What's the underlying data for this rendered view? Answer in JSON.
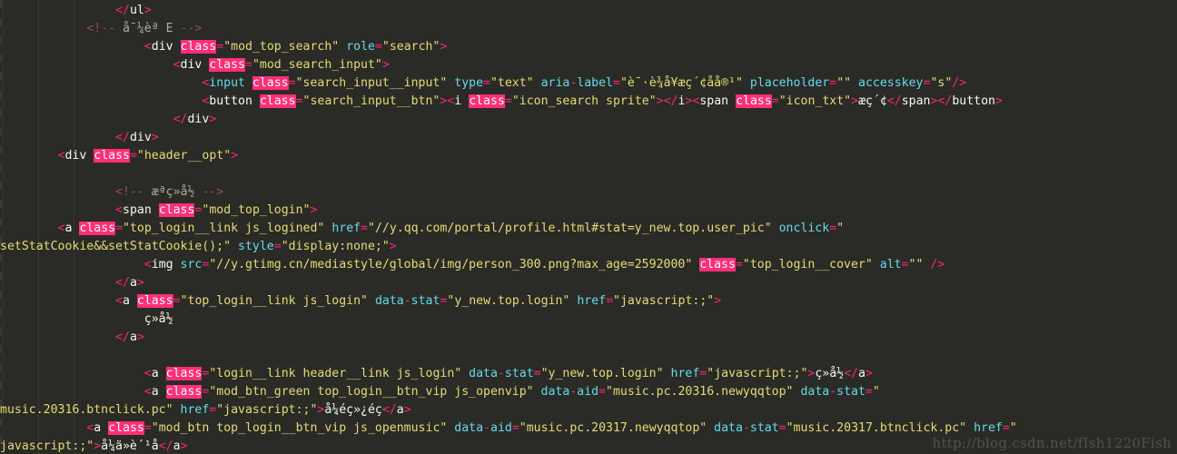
{
  "editor": {
    "title": "HTML source code editor",
    "theme": "Monokai",
    "colors": {
      "background": "#2a2b26",
      "foreground": "#f8f8f2",
      "punctuation": "#f92672",
      "attribute": "#66d9ef",
      "string": "#e6db74",
      "comment": "#9a4a55",
      "highlight_bg": "#ff2e79",
      "highlight_fg": "#ffffff",
      "indent_guide": "#3b3c36"
    },
    "search_highlight_term": "class"
  },
  "watermark": "http://blog.csdn.net/fIsh1220Fish",
  "lines": [
    {
      "id": "line-1",
      "indent": "                ",
      "tokens": [
        {
          "t": "pn",
          "s": "</"
        },
        {
          "t": "tag",
          "s": "ul"
        },
        {
          "t": "pn",
          "s": ">"
        }
      ]
    },
    {
      "id": "line-2",
      "indent": "            ",
      "tokens": [
        {
          "t": "cmt",
          "s": "<!-- "
        },
        {
          "t": "cmtt",
          "s": "å¯¼èª E"
        },
        {
          "t": "cmt",
          "s": " -->"
        }
      ]
    },
    {
      "id": "line-3",
      "indent": "                    ",
      "tokens": [
        {
          "t": "pn",
          "s": "<"
        },
        {
          "t": "tag",
          "s": "div"
        },
        {
          "t": "sp",
          "s": " "
        },
        {
          "t": "hl",
          "s": "class"
        },
        {
          "t": "eq",
          "s": "="
        },
        {
          "t": "val",
          "s": "\"mod_top_search\""
        },
        {
          "t": "sp",
          "s": " "
        },
        {
          "t": "attr",
          "s": "role"
        },
        {
          "t": "eq",
          "s": "="
        },
        {
          "t": "val",
          "s": "\"search\""
        },
        {
          "t": "pn",
          "s": ">"
        }
      ]
    },
    {
      "id": "line-4",
      "indent": "                        ",
      "tokens": [
        {
          "t": "pn",
          "s": "<"
        },
        {
          "t": "tag",
          "s": "div"
        },
        {
          "t": "sp",
          "s": " "
        },
        {
          "t": "hl",
          "s": "class"
        },
        {
          "t": "eq",
          "s": "="
        },
        {
          "t": "val",
          "s": "\"mod_search_input\""
        },
        {
          "t": "pn",
          "s": ">"
        }
      ]
    },
    {
      "id": "line-5",
      "indent": "                            ",
      "tokens": [
        {
          "t": "pn",
          "s": "<"
        },
        {
          "t": "tagc",
          "s": "input"
        },
        {
          "t": "sp",
          "s": " "
        },
        {
          "t": "hl",
          "s": "class"
        },
        {
          "t": "eq",
          "s": "="
        },
        {
          "t": "val",
          "s": "\"search_input__input\""
        },
        {
          "t": "sp",
          "s": " "
        },
        {
          "t": "attr",
          "s": "type"
        },
        {
          "t": "eq",
          "s": "="
        },
        {
          "t": "val",
          "s": "\"text\""
        },
        {
          "t": "sp",
          "s": " "
        },
        {
          "t": "attr",
          "s": "aria"
        },
        {
          "t": "pn",
          "s": "-"
        },
        {
          "t": "attr",
          "s": "label"
        },
        {
          "t": "eq",
          "s": "="
        },
        {
          "t": "val",
          "s": "\"è¯·è¾å¥æç´¢åå®¹\""
        },
        {
          "t": "sp",
          "s": " "
        },
        {
          "t": "attr",
          "s": "placeholder"
        },
        {
          "t": "eq",
          "s": "="
        },
        {
          "t": "val",
          "s": "\"\""
        },
        {
          "t": "sp",
          "s": " "
        },
        {
          "t": "attr",
          "s": "accesskey"
        },
        {
          "t": "eq",
          "s": "="
        },
        {
          "t": "val",
          "s": "\"s\""
        },
        {
          "t": "pn",
          "s": "/>"
        }
      ]
    },
    {
      "id": "line-6",
      "indent": "                            ",
      "tokens": [
        {
          "t": "pn",
          "s": "<"
        },
        {
          "t": "tag",
          "s": "button"
        },
        {
          "t": "sp",
          "s": " "
        },
        {
          "t": "hl",
          "s": "class"
        },
        {
          "t": "eq",
          "s": "="
        },
        {
          "t": "val",
          "s": "\"search_input__btn\""
        },
        {
          "t": "pn",
          "s": ">"
        },
        {
          "t": "pn",
          "s": "<"
        },
        {
          "t": "tag",
          "s": "i"
        },
        {
          "t": "sp",
          "s": " "
        },
        {
          "t": "hl",
          "s": "class"
        },
        {
          "t": "eq",
          "s": "="
        },
        {
          "t": "val",
          "s": "\"icon_search sprite\""
        },
        {
          "t": "pn",
          "s": ">"
        },
        {
          "t": "pn",
          "s": "</"
        },
        {
          "t": "tag",
          "s": "i"
        },
        {
          "t": "pn",
          "s": ">"
        },
        {
          "t": "pn",
          "s": "<"
        },
        {
          "t": "tag",
          "s": "span"
        },
        {
          "t": "sp",
          "s": " "
        },
        {
          "t": "hl",
          "s": "class"
        },
        {
          "t": "eq",
          "s": "="
        },
        {
          "t": "val",
          "s": "\"icon_txt\""
        },
        {
          "t": "pn",
          "s": ">"
        },
        {
          "t": "txt",
          "s": "æç´¢"
        },
        {
          "t": "pn",
          "s": "</"
        },
        {
          "t": "tag",
          "s": "span"
        },
        {
          "t": "pn",
          "s": ">"
        },
        {
          "t": "pn",
          "s": "</"
        },
        {
          "t": "tag",
          "s": "button"
        },
        {
          "t": "pn",
          "s": ">"
        }
      ]
    },
    {
      "id": "line-7",
      "indent": "                        ",
      "tokens": [
        {
          "t": "pn",
          "s": "</"
        },
        {
          "t": "tag",
          "s": "div"
        },
        {
          "t": "pn",
          "s": ">"
        }
      ]
    },
    {
      "id": "line-8",
      "indent": "                ",
      "tokens": [
        {
          "t": "pn",
          "s": "</"
        },
        {
          "t": "tag",
          "s": "div"
        },
        {
          "t": "pn",
          "s": ">"
        }
      ]
    },
    {
      "id": "line-9",
      "indent": "        ",
      "tokens": [
        {
          "t": "pn",
          "s": "<"
        },
        {
          "t": "tag",
          "s": "div"
        },
        {
          "t": "sp",
          "s": " "
        },
        {
          "t": "hl",
          "s": "class"
        },
        {
          "t": "eq",
          "s": "="
        },
        {
          "t": "val",
          "s": "\"header__opt\""
        },
        {
          "t": "pn",
          "s": ">"
        }
      ]
    },
    {
      "id": "line-10",
      "indent": "",
      "tokens": []
    },
    {
      "id": "line-11",
      "indent": "                ",
      "tokens": [
        {
          "t": "cmt",
          "s": "<!-- "
        },
        {
          "t": "cmtt",
          "s": "æªç»å½"
        },
        {
          "t": "cmt",
          "s": " -->"
        }
      ]
    },
    {
      "id": "line-12",
      "indent": "                ",
      "tokens": [
        {
          "t": "pn",
          "s": "<"
        },
        {
          "t": "tag",
          "s": "span"
        },
        {
          "t": "sp",
          "s": " "
        },
        {
          "t": "hl",
          "s": "class"
        },
        {
          "t": "eq",
          "s": "="
        },
        {
          "t": "val",
          "s": "\"mod_top_login\""
        },
        {
          "t": "pn",
          "s": ">"
        }
      ]
    },
    {
      "id": "line-13",
      "indent": "        ",
      "tokens": [
        {
          "t": "pn",
          "s": "<"
        },
        {
          "t": "tag",
          "s": "a"
        },
        {
          "t": "sp",
          "s": " "
        },
        {
          "t": "hl",
          "s": "class"
        },
        {
          "t": "eq",
          "s": "="
        },
        {
          "t": "val",
          "s": "\"top_login__link js_logined\""
        },
        {
          "t": "sp",
          "s": " "
        },
        {
          "t": "attr",
          "s": "href"
        },
        {
          "t": "eq",
          "s": "="
        },
        {
          "t": "val",
          "s": "\"//y.qq.com/portal/profile.html#stat=y_new.top.user_pic\""
        },
        {
          "t": "sp",
          "s": " "
        },
        {
          "t": "attr",
          "s": "onclick"
        },
        {
          "t": "eq",
          "s": "="
        },
        {
          "t": "val",
          "s": "\""
        }
      ]
    },
    {
      "id": "line-14",
      "indent": "",
      "tokens": [
        {
          "t": "val",
          "s": "setStatCookie&&setStatCookie();\""
        },
        {
          "t": "sp",
          "s": " "
        },
        {
          "t": "attr",
          "s": "style"
        },
        {
          "t": "eq",
          "s": "="
        },
        {
          "t": "val",
          "s": "\"display:none;\""
        },
        {
          "t": "pn",
          "s": ">"
        }
      ]
    },
    {
      "id": "line-15",
      "indent": "                    ",
      "tokens": [
        {
          "t": "pn",
          "s": "<"
        },
        {
          "t": "tag",
          "s": "img"
        },
        {
          "t": "sp",
          "s": " "
        },
        {
          "t": "attr",
          "s": "src"
        },
        {
          "t": "eq",
          "s": "="
        },
        {
          "t": "val",
          "s": "\"//y.gtimg.cn/mediastyle/global/img/person_300.png?max_age=2592000\""
        },
        {
          "t": "sp",
          "s": " "
        },
        {
          "t": "hl",
          "s": "class"
        },
        {
          "t": "eq",
          "s": "="
        },
        {
          "t": "val",
          "s": "\"top_login__cover\""
        },
        {
          "t": "sp",
          "s": " "
        },
        {
          "t": "attr",
          "s": "alt"
        },
        {
          "t": "eq",
          "s": "="
        },
        {
          "t": "val",
          "s": "\"\""
        },
        {
          "t": "sp",
          "s": " "
        },
        {
          "t": "pn",
          "s": "/>"
        }
      ]
    },
    {
      "id": "line-16",
      "indent": "                ",
      "tokens": [
        {
          "t": "pn",
          "s": "</"
        },
        {
          "t": "tag",
          "s": "a"
        },
        {
          "t": "pn",
          "s": ">"
        }
      ]
    },
    {
      "id": "line-17",
      "indent": "                ",
      "tokens": [
        {
          "t": "pn",
          "s": "<"
        },
        {
          "t": "tag",
          "s": "a"
        },
        {
          "t": "sp",
          "s": " "
        },
        {
          "t": "hl",
          "s": "class"
        },
        {
          "t": "eq",
          "s": "="
        },
        {
          "t": "val",
          "s": "\"top_login__link js_login\""
        },
        {
          "t": "sp",
          "s": " "
        },
        {
          "t": "attr",
          "s": "data"
        },
        {
          "t": "pn",
          "s": "-"
        },
        {
          "t": "attr",
          "s": "stat"
        },
        {
          "t": "eq",
          "s": "="
        },
        {
          "t": "val",
          "s": "\"y_new.top.login\""
        },
        {
          "t": "sp",
          "s": " "
        },
        {
          "t": "attr",
          "s": "href"
        },
        {
          "t": "eq",
          "s": "="
        },
        {
          "t": "val",
          "s": "\"javascript:;\""
        },
        {
          "t": "pn",
          "s": ">"
        }
      ]
    },
    {
      "id": "line-18",
      "indent": "                    ",
      "tokens": [
        {
          "t": "txt",
          "s": "ç»å½"
        }
      ]
    },
    {
      "id": "line-19",
      "indent": "                ",
      "tokens": [
        {
          "t": "pn",
          "s": "</"
        },
        {
          "t": "tag",
          "s": "a"
        },
        {
          "t": "pn",
          "s": ">"
        }
      ]
    },
    {
      "id": "line-20",
      "indent": "",
      "tokens": []
    },
    {
      "id": "line-21",
      "indent": "                    ",
      "tokens": [
        {
          "t": "pn",
          "s": "<"
        },
        {
          "t": "tag",
          "s": "a"
        },
        {
          "t": "sp",
          "s": " "
        },
        {
          "t": "hl",
          "s": "class"
        },
        {
          "t": "eq",
          "s": "="
        },
        {
          "t": "val",
          "s": "\"login__link header__link js_login\""
        },
        {
          "t": "sp",
          "s": " "
        },
        {
          "t": "attr",
          "s": "data"
        },
        {
          "t": "pn",
          "s": "-"
        },
        {
          "t": "attr",
          "s": "stat"
        },
        {
          "t": "eq",
          "s": "="
        },
        {
          "t": "val",
          "s": "\"y_new.top.login\""
        },
        {
          "t": "sp",
          "s": " "
        },
        {
          "t": "attr",
          "s": "href"
        },
        {
          "t": "eq",
          "s": "="
        },
        {
          "t": "val",
          "s": "\"javascript:;\""
        },
        {
          "t": "pn",
          "s": ">"
        },
        {
          "t": "txt",
          "s": "ç»å½"
        },
        {
          "t": "pn",
          "s": "</"
        },
        {
          "t": "tag",
          "s": "a"
        },
        {
          "t": "pn",
          "s": ">"
        }
      ]
    },
    {
      "id": "line-22",
      "indent": "                    ",
      "tokens": [
        {
          "t": "pn",
          "s": "<"
        },
        {
          "t": "tag",
          "s": "a"
        },
        {
          "t": "sp",
          "s": " "
        },
        {
          "t": "hl",
          "s": "class"
        },
        {
          "t": "eq",
          "s": "="
        },
        {
          "t": "val",
          "s": "\"mod_btn_green top_login__btn_vip js_openvip\""
        },
        {
          "t": "sp",
          "s": " "
        },
        {
          "t": "attr",
          "s": "data"
        },
        {
          "t": "pn",
          "s": "-"
        },
        {
          "t": "attr",
          "s": "aid"
        },
        {
          "t": "eq",
          "s": "="
        },
        {
          "t": "val",
          "s": "\"music.pc.20316.newyqqtop\""
        },
        {
          "t": "sp",
          "s": " "
        },
        {
          "t": "attr",
          "s": "data"
        },
        {
          "t": "pn",
          "s": "-"
        },
        {
          "t": "attr",
          "s": "stat"
        },
        {
          "t": "eq",
          "s": "="
        },
        {
          "t": "val",
          "s": "\""
        }
      ]
    },
    {
      "id": "line-23",
      "indent": "",
      "tokens": [
        {
          "t": "val",
          "s": "music.20316.btnclick.pc\""
        },
        {
          "t": "sp",
          "s": " "
        },
        {
          "t": "attr",
          "s": "href"
        },
        {
          "t": "eq",
          "s": "="
        },
        {
          "t": "val",
          "s": "\"javascript:;\""
        },
        {
          "t": "pn",
          "s": ">"
        },
        {
          "t": "txt",
          "s": "å¼éç»¿éç"
        },
        {
          "t": "pn",
          "s": "</"
        },
        {
          "t": "tag",
          "s": "a"
        },
        {
          "t": "pn",
          "s": ">"
        }
      ]
    },
    {
      "id": "line-24",
      "indent": "            ",
      "tokens": [
        {
          "t": "pn",
          "s": "<"
        },
        {
          "t": "tag",
          "s": "a"
        },
        {
          "t": "sp",
          "s": " "
        },
        {
          "t": "hl",
          "s": "class"
        },
        {
          "t": "eq",
          "s": "="
        },
        {
          "t": "val",
          "s": "\"mod_btn top_login__btn_vip js_openmusic\""
        },
        {
          "t": "sp",
          "s": " "
        },
        {
          "t": "attr",
          "s": "data"
        },
        {
          "t": "pn",
          "s": "-"
        },
        {
          "t": "attr",
          "s": "aid"
        },
        {
          "t": "eq",
          "s": "="
        },
        {
          "t": "val",
          "s": "\"music.pc.20317.newyqqtop\""
        },
        {
          "t": "sp",
          "s": " "
        },
        {
          "t": "attr",
          "s": "data"
        },
        {
          "t": "pn",
          "s": "-"
        },
        {
          "t": "attr",
          "s": "stat"
        },
        {
          "t": "eq",
          "s": "="
        },
        {
          "t": "val",
          "s": "\"music.20317.btnclick.pc\""
        },
        {
          "t": "sp",
          "s": " "
        },
        {
          "t": "attr",
          "s": "href"
        },
        {
          "t": "eq",
          "s": "="
        },
        {
          "t": "val",
          "s": "\""
        }
      ]
    },
    {
      "id": "line-25",
      "indent": "",
      "tokens": [
        {
          "t": "val",
          "s": "javascript:;\""
        },
        {
          "t": "pn",
          "s": ">"
        },
        {
          "t": "txt",
          "s": "å¼ä»è´¹å"
        },
        {
          "t": "pn",
          "s": "</"
        },
        {
          "t": "tag",
          "s": "a"
        },
        {
          "t": "pn",
          "s": ">"
        }
      ]
    }
  ]
}
